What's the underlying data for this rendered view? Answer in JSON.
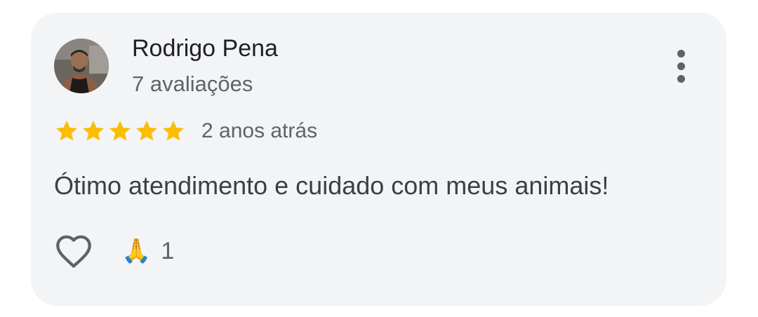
{
  "review": {
    "author": {
      "name": "Rodrigo Pena",
      "review_count_text": "7 avaliações",
      "avatar_icon": "user-photo"
    },
    "rating": {
      "stars": 5,
      "max": 5,
      "color": "#fbbc04"
    },
    "time_ago": "2 anos atrás",
    "text": "Ótimo atendimento e cuidado com meus animais!",
    "actions": {
      "like_icon": "heart-outline-icon",
      "reaction_emoji": "🙏",
      "reaction_count": "1"
    },
    "menu_icon": "more-vert-icon"
  },
  "colors": {
    "card_bg": "#f3f4f6",
    "primary_text": "#202124",
    "secondary_text": "#5f6368",
    "star": "#fbbc04"
  }
}
